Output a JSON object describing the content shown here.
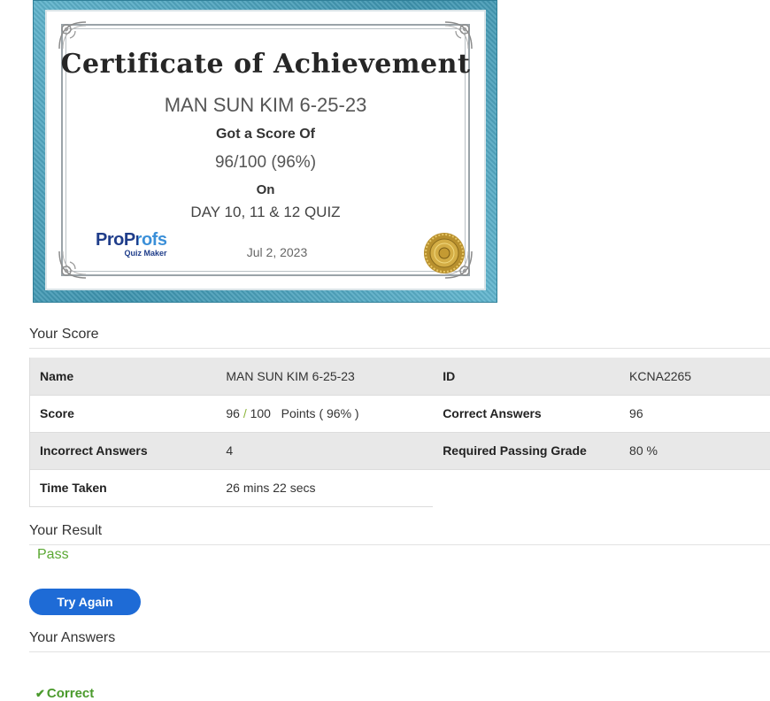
{
  "certificate": {
    "title": "Certificate of Achievement",
    "name": "MAN SUN KIM 6-25-23",
    "score_prefix": "Got a Score Of",
    "score": "96/100 (96%)",
    "on_label": "On",
    "quiz_name": "DAY 10, 11 & 12 QUIZ",
    "date": "Jul 2, 2023",
    "logo": {
      "main": "ProProfs",
      "sub": "Quiz Maker"
    },
    "seal_icon": "gold-seal-icon",
    "frame_color": "#4aa3bf"
  },
  "your_score": {
    "heading": "Your Score",
    "rows": [
      {
        "label1": "Name",
        "value1": "MAN SUN KIM 6-25-23",
        "label2": "ID",
        "value2": "KCNA2265"
      },
      {
        "label1": "Score",
        "value1_score": "96",
        "value1_slash": "/",
        "value1_total": "100",
        "value1_points": "Points ( 96% )",
        "label2": "Correct Answers",
        "value2": "96"
      },
      {
        "label1": "Incorrect Answers",
        "value1": "4",
        "label2": "Required Passing Grade",
        "value2": "80 %"
      },
      {
        "label1": "Time Taken",
        "value1": "26 mins 22 secs"
      }
    ]
  },
  "your_result": {
    "heading": "Your Result",
    "status": "Pass",
    "status_color": "#5aa832"
  },
  "try_again": {
    "label": "Try Again",
    "color": "#1e6bd6"
  },
  "your_answers": {
    "heading": "Your Answers",
    "first_status": "Correct",
    "first_status_icon": "check-icon"
  }
}
